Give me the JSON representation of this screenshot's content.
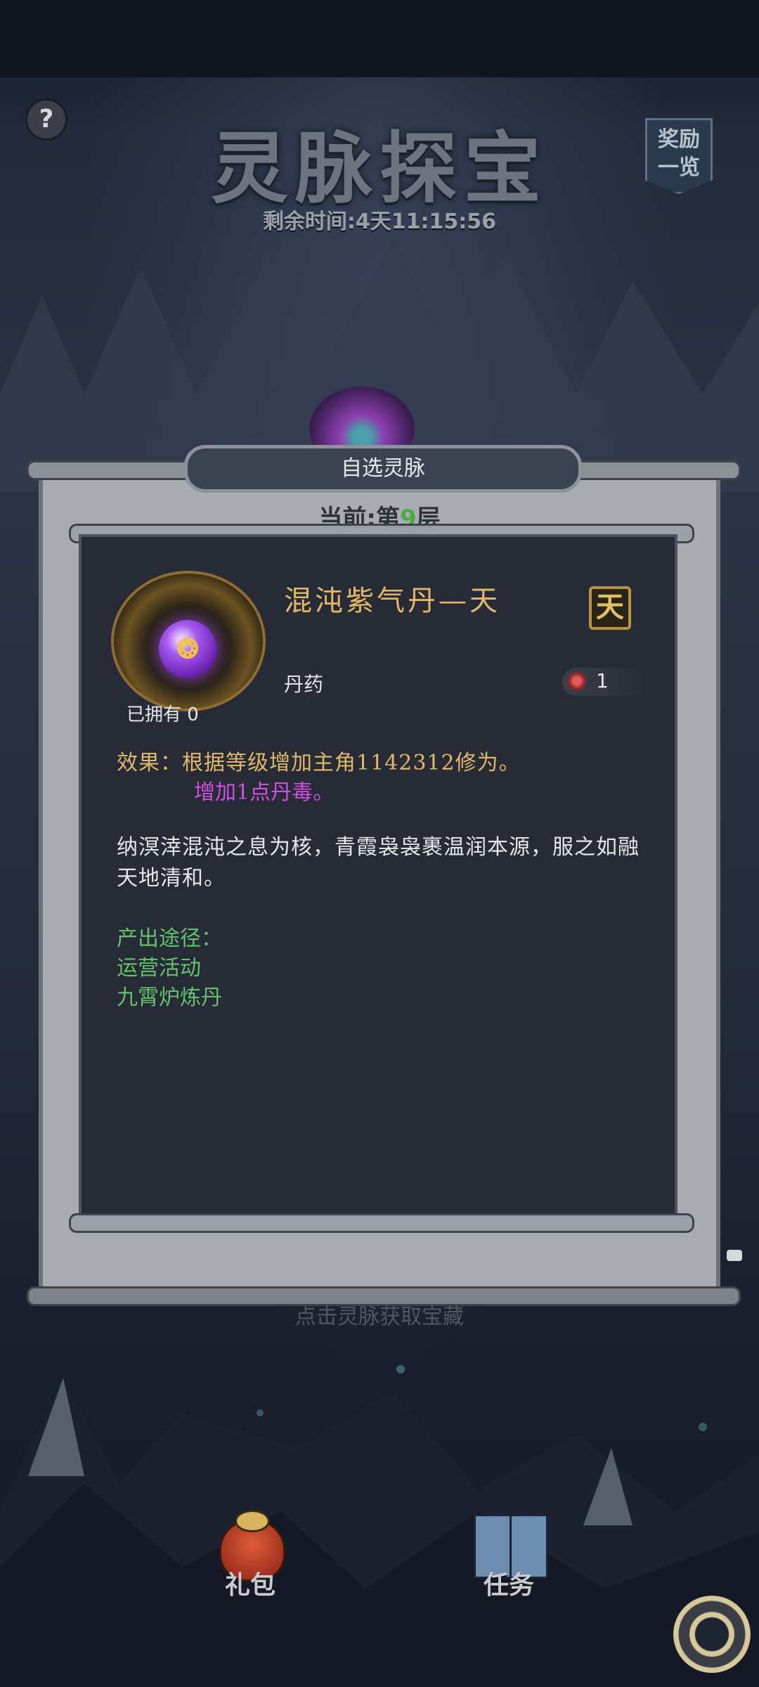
{
  "header": {
    "title": "灵脉探宝",
    "timer": "剩余时间:4天11:15:56",
    "help_label": "?",
    "reward_label_line1": "奖励",
    "reward_label_line2": "一览"
  },
  "dialog": {
    "tab_label": "自选灵脉",
    "floor_prefix": "当前:第",
    "floor_number": "9",
    "floor_suffix": "层"
  },
  "item": {
    "name": "混沌紫气丹—天",
    "bind_badge": "天",
    "owned_text": "已拥有 0",
    "type": "丹药",
    "toxin_value": "1",
    "effect_line": "效果：根据等级增加主角1142312修为。",
    "effect_extra": "增加1点丹毒。",
    "description": "纳溟涬混沌之息为核，青霞袅袅裹温润本源，服之如融天地清和。",
    "source_title": "产出途径：",
    "sources": [
      "运营活动",
      "九霄炉炼丹"
    ]
  },
  "background": {
    "obscured_text": "点击灵脉获取宝藏"
  },
  "bottom_nav": {
    "gift_label": "礼包",
    "task_label": "任务"
  },
  "colors": {
    "gold": "#e2b769",
    "purple": "#d04fe0",
    "green": "#63c26b",
    "floor_number": "#4caa44"
  }
}
